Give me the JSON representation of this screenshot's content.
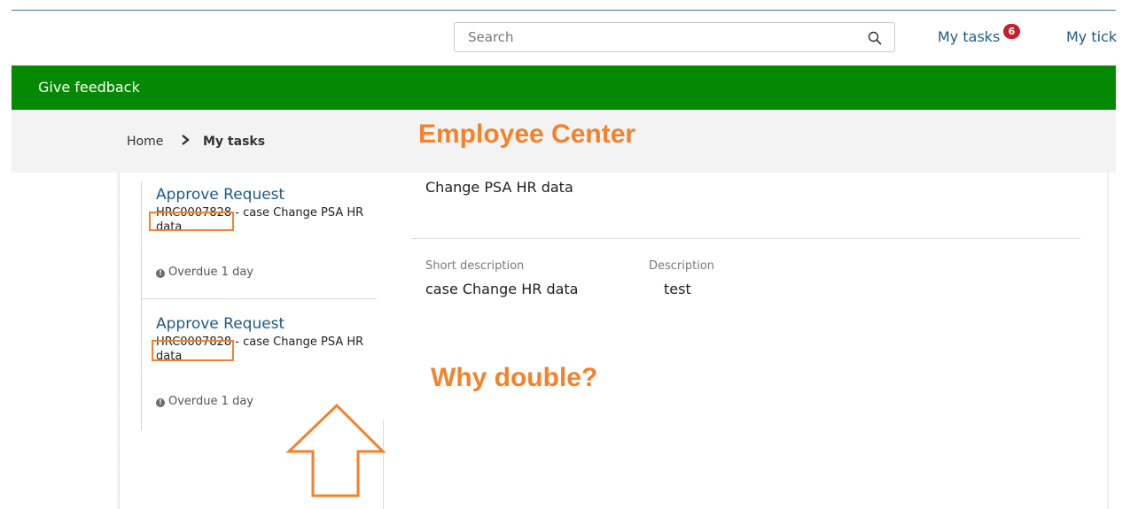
{
  "header": {
    "search_placeholder": "Search",
    "nav": {
      "my_tasks_label": "My tasks",
      "my_tasks_count": "6",
      "my_tickets_label": "My tick"
    }
  },
  "feedback": {
    "label": "Give feedback"
  },
  "breadcrumb": {
    "home": "Home",
    "current": "My tasks"
  },
  "annotations": {
    "title": "Employee Center",
    "question": "Why double?",
    "accent_color": "#f2822b"
  },
  "task_list": [
    {
      "title": "Approve Request",
      "number": "HRC0007828",
      "description": " - case Change PSA HR data",
      "status": "Overdue 1 day"
    },
    {
      "title": "Approve Request",
      "number": "HRC0007828",
      "description": " - case Change PSA HR data",
      "status": "Overdue 1 day"
    }
  ],
  "detail": {
    "title": "Change PSA HR data",
    "short_description_label": "Short description",
    "short_description_value": "case Change HR data",
    "description_label": "Description",
    "description_value": "test"
  },
  "colors": {
    "brand_green": "#038a00",
    "link_blue": "#1d5a87",
    "badge_red": "#c3202f"
  }
}
